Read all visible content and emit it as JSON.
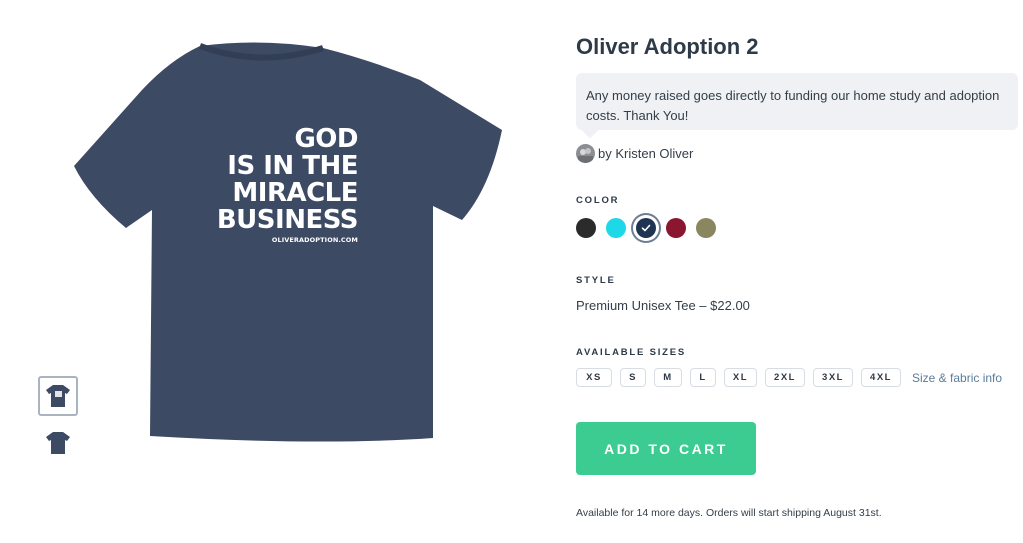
{
  "product": {
    "title": "Oliver Adoption 2",
    "description": "Any money raised goes directly to funding our home study and adoption costs. Thank You!",
    "author": "by Kristen Oliver",
    "shirt_print": {
      "lines": [
        "GOD",
        "IS IN THE",
        "MIRACLE",
        "BUSINESS"
      ],
      "site": "OLIVERADOPTION.COM"
    }
  },
  "color": {
    "label": "COLOR",
    "options": [
      {
        "hex": "#2b2b2b",
        "selected": false
      },
      {
        "hex": "#1ed8e8",
        "selected": false
      },
      {
        "hex": "#1f3352",
        "selected": true
      },
      {
        "hex": "#8b1630",
        "selected": false
      },
      {
        "hex": "#8a8760",
        "selected": false
      }
    ]
  },
  "style": {
    "label": "STYLE",
    "value": "Premium Unisex Tee – $22.00"
  },
  "sizes": {
    "label": "AVAILABLE SIZES",
    "options": [
      "XS",
      "S",
      "M",
      "L",
      "XL",
      "2XL",
      "3XL",
      "4XL"
    ],
    "info_link": "Size & fabric info"
  },
  "cart": {
    "button": "ADD TO CART",
    "note": "Available for 14 more days. Orders will start shipping August 31st."
  },
  "colors": {
    "shirt": "#3c4a63",
    "accent": "#3ccb91",
    "link": "#5b7c9a"
  }
}
